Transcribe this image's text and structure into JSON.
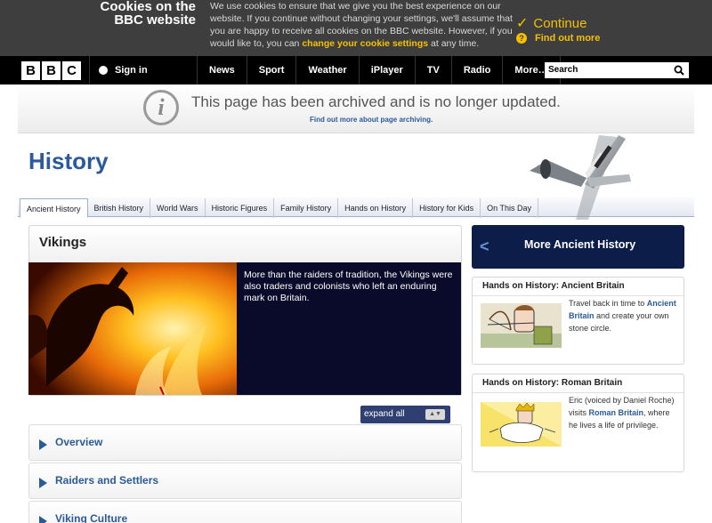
{
  "cookie_banner": {
    "title_line1": "Cookies on the",
    "title_line2": "BBC website",
    "text_part1": "We use cookies to ensure that we give you the best experience on our website. If you continue without changing your settings, we'll assume that you are happy to receive all cookies on the BBC website. However, if you would like to, you can ",
    "text_link": "change your cookie settings",
    "text_part2": " at any time.",
    "continue_label": "Continue",
    "find_out_more_label": "Find out more"
  },
  "nav": {
    "logo_letters": [
      "B",
      "B",
      "C"
    ],
    "signin_label": "Sign in",
    "links": [
      "News",
      "Sport",
      "Weather",
      "iPlayer",
      "TV",
      "Radio",
      "More…"
    ],
    "search_placeholder": "Search"
  },
  "archive": {
    "icon_letter": "i",
    "title": "This page has been archived and is no longer updated.",
    "link": "Find out more about page archiving."
  },
  "page": {
    "title": "History",
    "tabs": [
      "Ancient History",
      "British History",
      "World Wars",
      "Historic Figures",
      "Family History",
      "Hands on History",
      "History for Kids",
      "On This Day"
    ]
  },
  "main": {
    "section_title": "Vikings",
    "hero_text": "More than the raiders of tradition, the Vikings were also traders and colonists who left an enduring mark on Britain.",
    "expand_label": "expand all",
    "accordion": [
      "Overview",
      "Raiders and Settlers",
      "Viking Culture"
    ]
  },
  "sidebar": {
    "header": "More Ancient History",
    "cards": [
      {
        "title": "Hands on History: Ancient Britain",
        "desc_part1": "Travel back in time to ",
        "desc_link": "Ancient Britain",
        "desc_part2": " and create your own stone circle."
      },
      {
        "title": "Hands on History: Roman Britain",
        "desc_part1": "Eric (voiced by Daniel Roche) visits ",
        "desc_link": "Roman Britain",
        "desc_part2": ", where he lives a life of privilege."
      }
    ]
  },
  "colors": {
    "brand_blue": "#2b5a9a",
    "cookie_accent": "#f5c000",
    "hero_navy": "#0a0a2a"
  }
}
